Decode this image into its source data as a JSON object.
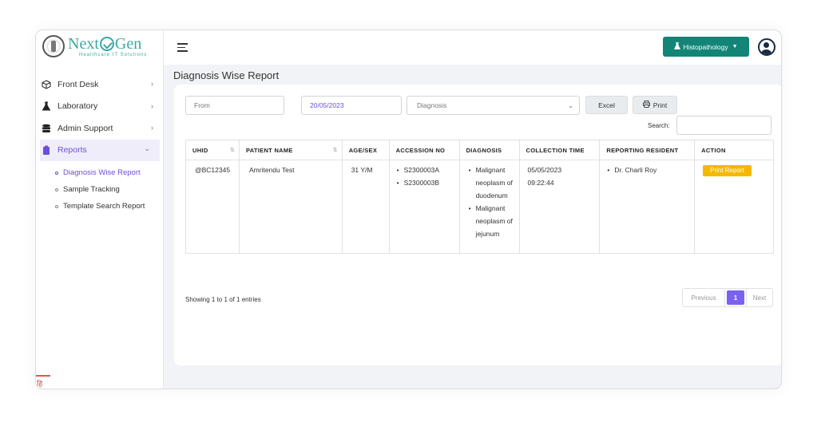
{
  "logo": {
    "brand_left": "Next",
    "brand_right": "Gen",
    "tagline": "Healthcare IT Solutions"
  },
  "sidebar": {
    "items": [
      {
        "label": "Front Desk",
        "icon": "cube-icon",
        "chevron": "›"
      },
      {
        "label": "Laboratory",
        "icon": "flask-icon",
        "chevron": "›"
      },
      {
        "label": "Admin Support",
        "icon": "database-icon",
        "chevron": "›"
      },
      {
        "label": "Reports",
        "icon": "clipboard-icon",
        "chevron": "⌄"
      }
    ],
    "sub_items": [
      "Diagnosis Wise Report",
      "Sample Tracking",
      "Template Search Report"
    ],
    "footer_glyph": "हि"
  },
  "topbar": {
    "department": "Histopathology",
    "department_caret": "▼"
  },
  "page": {
    "title": "Diagnosis Wise Report"
  },
  "filters": {
    "from_placeholder": "From",
    "to_value": "20/05/2023",
    "diagnosis_placeholder": "Diagnosis",
    "excel_label": "Excel",
    "print_label": "Print",
    "search_label": "Search:"
  },
  "table": {
    "headers": [
      "UHID",
      "PATIENT NAME",
      "AGE/SEX",
      "ACCESSION NO",
      "DIAGNOSIS",
      "COLLECTION TIME",
      "REPORTING RESIDENT",
      "ACTION"
    ],
    "rows": [
      {
        "uhid": "@BC12345",
        "patient_name": "Amritendu Test",
        "age_sex": "31 Y/M",
        "accession": [
          "S2300003A",
          "S2300003B"
        ],
        "diagnosis": [
          "Malignant neoplasm of duodenum",
          "Malignant neoplasm of jejunum"
        ],
        "collection_date": "05/05/2023",
        "collection_time": "09:22:44",
        "resident": "Dr. Charli Roy",
        "action": "Print Report"
      }
    ]
  },
  "footer": {
    "info": "Showing 1 to 1 of 1 entries",
    "prev": "Previous",
    "current": "1",
    "next": "Next"
  },
  "colors": {
    "accent": "#6b4fd8",
    "department_button": "#128577",
    "action_button": "#f5b800"
  }
}
